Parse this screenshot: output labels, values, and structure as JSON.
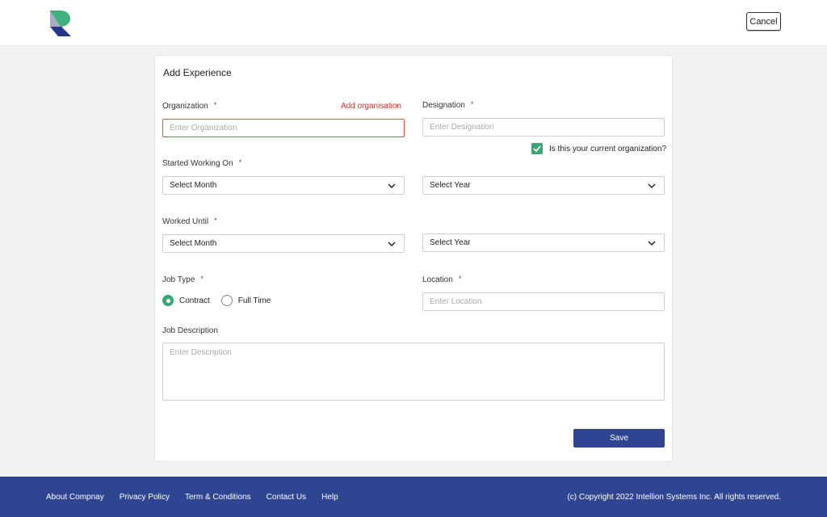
{
  "header": {
    "logo": "intellion-logo",
    "cancel_label": "Cancel"
  },
  "form": {
    "title": "Add Experience",
    "required_marker": "*",
    "organization": {
      "label": "Organization",
      "placeholder": "Enter Organization",
      "value": "",
      "add_link": "Add organisation",
      "error": true
    },
    "designation": {
      "label": "Designation",
      "placeholder": "Enter Designation",
      "value": ""
    },
    "current_org": {
      "label": "Is this your current organization?",
      "checked": true
    },
    "started_working_on": {
      "label": "Started Working On",
      "month": "Select Month",
      "year": "Select Year"
    },
    "worked_until": {
      "label": "Worked Until",
      "month": "Select Month",
      "year": "Select Year"
    },
    "job_type": {
      "label": "Job Type",
      "options": [
        {
          "label": "Contract",
          "selected": true
        },
        {
          "label": "Full Time",
          "selected": false
        }
      ]
    },
    "location": {
      "label": "Location",
      "placeholder": "Enter Location",
      "value": ""
    },
    "job_description": {
      "label": "Job Description",
      "placeholder": "Enter Description",
      "value": ""
    },
    "save_label": "Save"
  },
  "footer": {
    "links": [
      "About Compnay",
      "Privacy Policy",
      "Term & Conditions",
      "Contact Us",
      "Help"
    ],
    "copyright": "(c) Copyright 2022 Intellion Systems Inc. All rights reserved."
  },
  "colors": {
    "brand_blue": "#2f4591",
    "accent_green": "#3aa776",
    "error_red": "#d32f2f"
  }
}
